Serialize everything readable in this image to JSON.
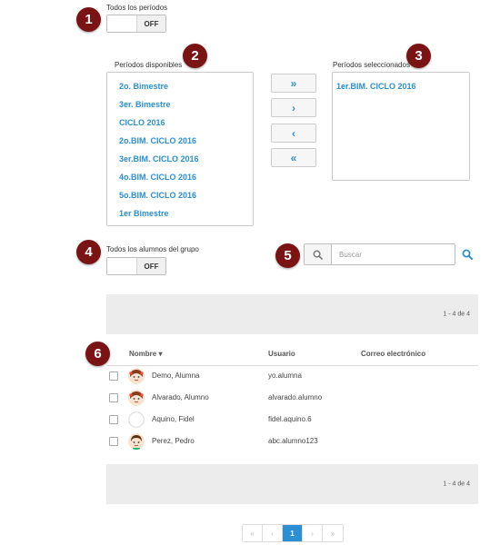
{
  "badges": [
    "1",
    "2",
    "3",
    "4",
    "5",
    "6"
  ],
  "all_periods": {
    "label": "Todos los períodos",
    "toggle_state": "OFF"
  },
  "available": {
    "label": "Períodos disponibles",
    "items": [
      "2o. Bimestre",
      "3er. Bimestre",
      "CICLO 2016",
      "2o.BIM. CICLO 2016",
      "3er.BIM. CICLO 2016",
      "4o.BIM. CICLO 2016",
      "5o.BIM. CICLO 2016",
      "1er Bimestre"
    ]
  },
  "selected": {
    "label": "Períodos seleccionados",
    "items": [
      "1er.BIM. CICLO 2016"
    ]
  },
  "move_buttons": {
    "add_all": "»",
    "add_one": "›",
    "remove_one": "‹",
    "remove_all": "«"
  },
  "all_students": {
    "label": "Todos los alumnos del grupo",
    "toggle_state": "OFF"
  },
  "search": {
    "placeholder": "Buscar",
    "icon": "search-icon",
    "submit_icon": "zoom-icon"
  },
  "results": {
    "count_top": "1 - 4 de 4",
    "count_bottom": "1 - 4 de 4"
  },
  "table": {
    "columns": {
      "name": "Nombre ▾",
      "user": "Usuario",
      "email": "Correo electrónico"
    },
    "rows": [
      {
        "name": "Demo, Alumna",
        "user": "yo.alumna",
        "avatar": "girl-avatar"
      },
      {
        "name": "Alvarado, Alumno",
        "user": "alvarado.alumno",
        "avatar": "girl-avatar"
      },
      {
        "name": "Aquino, Fidel",
        "user": "fidel.aquino.6",
        "avatar": "empty-avatar"
      },
      {
        "name": "Perez, Pedro",
        "user": "abc.alumno123",
        "avatar": "boy-avatar"
      }
    ]
  },
  "pagination": {
    "first": "«",
    "prev": "‹",
    "current": "1",
    "next": "›",
    "last": "»"
  },
  "colors": {
    "accent": "#2b8fd1",
    "badge": "#7a1414",
    "bar": "#ececec"
  }
}
